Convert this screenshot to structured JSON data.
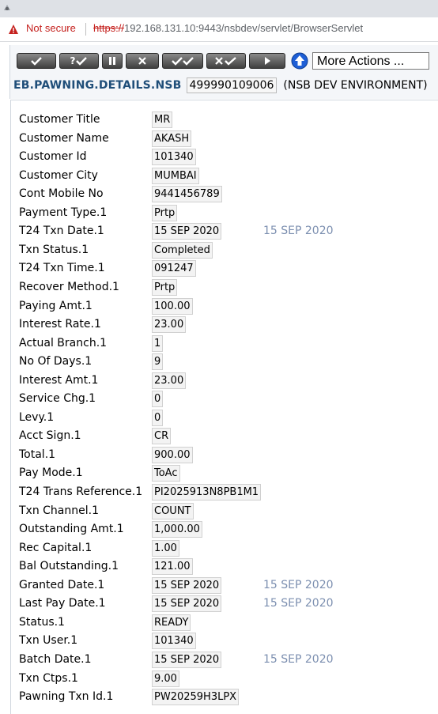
{
  "browser": {
    "security_text": "Not secure",
    "url_scheme": "https://",
    "url_rest": "192.168.131.10:9443/nsbdev/servlet/BrowserServlet"
  },
  "toolbar": {
    "buttons": [
      "commit",
      "validate",
      "hold",
      "delete",
      "authorise",
      "reverse",
      "next"
    ],
    "validate_label": "?",
    "more_actions": "More Actions ..."
  },
  "application": {
    "name": "EB.PAWNING.DETAILS.NSB",
    "id": "499990109006",
    "environment": "(NSB DEV ENVIRONMENT)"
  },
  "fields": [
    {
      "label": "Customer Title",
      "value": "MR",
      "extra": ""
    },
    {
      "label": "Customer Name",
      "value": "AKASH",
      "extra": ""
    },
    {
      "label": "Customer Id",
      "value": "101340",
      "extra": ""
    },
    {
      "label": "Customer City",
      "value": "MUMBAI",
      "extra": ""
    },
    {
      "label": "Cont Mobile No",
      "value": "9441456789",
      "extra": ""
    },
    {
      "label": "Payment Type.1",
      "value": "Prtp",
      "extra": ""
    },
    {
      "label": "T24 Txn Date.1",
      "value": "15 SEP 2020",
      "extra": "15 SEP 2020"
    },
    {
      "label": "Txn Status.1",
      "value": "Completed",
      "extra": ""
    },
    {
      "label": "T24 Txn Time.1",
      "value": "091247",
      "extra": ""
    },
    {
      "label": "Recover Method.1",
      "value": "Prtp",
      "extra": ""
    },
    {
      "label": "Paying Amt.1",
      "value": "100.00",
      "extra": ""
    },
    {
      "label": "Interest Rate.1",
      "value": "23.00",
      "extra": ""
    },
    {
      "label": "Actual Branch.1",
      "value": "1",
      "extra": ""
    },
    {
      "label": "No Of Days.1",
      "value": "9",
      "extra": ""
    },
    {
      "label": "Interest Amt.1",
      "value": "23.00",
      "extra": ""
    },
    {
      "label": "Service Chg.1",
      "value": "0",
      "extra": ""
    },
    {
      "label": "Levy.1",
      "value": "0",
      "extra": ""
    },
    {
      "label": "Acct Sign.1",
      "value": "CR",
      "extra": ""
    },
    {
      "label": "Total.1",
      "value": "900.00",
      "extra": ""
    },
    {
      "label": "Pay Mode.1",
      "value": "ToAc",
      "extra": ""
    },
    {
      "label": "T24 Trans Reference.1",
      "value": "PI2025913N8PB1M1",
      "extra": ""
    },
    {
      "label": "Txn Channel.1",
      "value": "COUNT",
      "extra": ""
    },
    {
      "label": "Outstanding Amt.1",
      "value": "1,000.00",
      "extra": ""
    },
    {
      "label": "Rec Capital.1",
      "value": "1.00",
      "extra": ""
    },
    {
      "label": "Bal Outstanding.1",
      "value": "121.00",
      "extra": ""
    },
    {
      "label": "Granted Date.1",
      "value": "15 SEP 2020",
      "extra": "15 SEP 2020"
    },
    {
      "label": "Last Pay Date.1",
      "value": "15 SEP 2020",
      "extra": "15 SEP 2020"
    },
    {
      "label": "Status.1",
      "value": "READY",
      "extra": ""
    },
    {
      "label": "Txn User.1",
      "value": "101340",
      "extra": ""
    },
    {
      "label": "Batch Date.1",
      "value": "15 SEP 2020",
      "extra": "15 SEP 2020"
    },
    {
      "label": "Txn Ctps.1",
      "value": "9.00",
      "extra": ""
    },
    {
      "label": "Pawning Txn Id.1",
      "value": "PW20259H3LPX",
      "extra": ""
    }
  ]
}
